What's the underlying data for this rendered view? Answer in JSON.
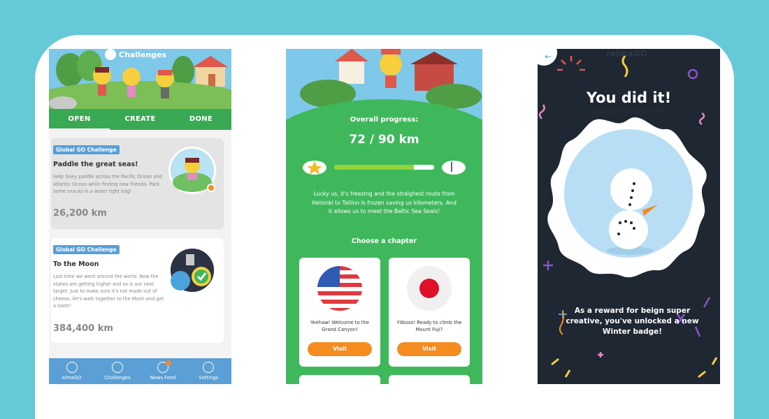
{
  "colors": {
    "teal_bg": "#66c9d7",
    "green": "#3fb85c",
    "blue": "#5a9fd6",
    "orange": "#f48c1f",
    "dark": "#1f2733"
  },
  "screen1": {
    "header_title": "Challenges",
    "tabs": [
      "OPEN",
      "CREATE",
      "DONE"
    ],
    "cards": [
      {
        "badge": "Global GO Challenge",
        "title": "Paddle the great seas!",
        "desc": "Help Goey paddle across the Pacific Ocean and Atlantic Ocean while finding new friends. Pack some snacks in a water tight bag!",
        "distance": "26,200 km"
      },
      {
        "badge": "Global GO Challenge",
        "title": "To the Moon",
        "desc": "Last time we went around the world. Now the stakes are getting higher and so is our next target. Just to make sure it's not made out of cheese, let's walk together to the Moon and get a taste!",
        "distance": "384,400 km"
      }
    ],
    "nav": [
      {
        "label": "eimaGO",
        "icon": "mascot-icon"
      },
      {
        "label": "Challenges",
        "icon": "challenges-icon"
      },
      {
        "label": "News Feed",
        "icon": "newsfeed-icon"
      },
      {
        "label": "Settings",
        "icon": "settings-icon"
      }
    ]
  },
  "screen2": {
    "progress_label": "Overall progress:",
    "progress_value": "72 / 90 km",
    "progress_fraction": 0.8,
    "description": "Lucky us, it's freezing and the straighest route from Helsinki to Tallinn is frozen saving us kilometers. And it allows us to meet the Baltic Sea Seals!",
    "chapter_heading": "Choose a chapter",
    "chapters": [
      {
        "flag": "usa-flag-icon",
        "text": "Yeehaw! Welcome to the Grand Canyon!",
        "button": "Visit"
      },
      {
        "flag": "japan-flag-icon",
        "text": "Yōkoso! Ready to climb the Mount Fuji?",
        "button": "Visit"
      }
    ]
  },
  "screen3": {
    "ghost_brand": "reimaGO",
    "ghost_sub": "hours of active play collected",
    "title": "You did it!",
    "message": "As a reward for beign super creative, you've unlocked a new Winter badge!"
  }
}
